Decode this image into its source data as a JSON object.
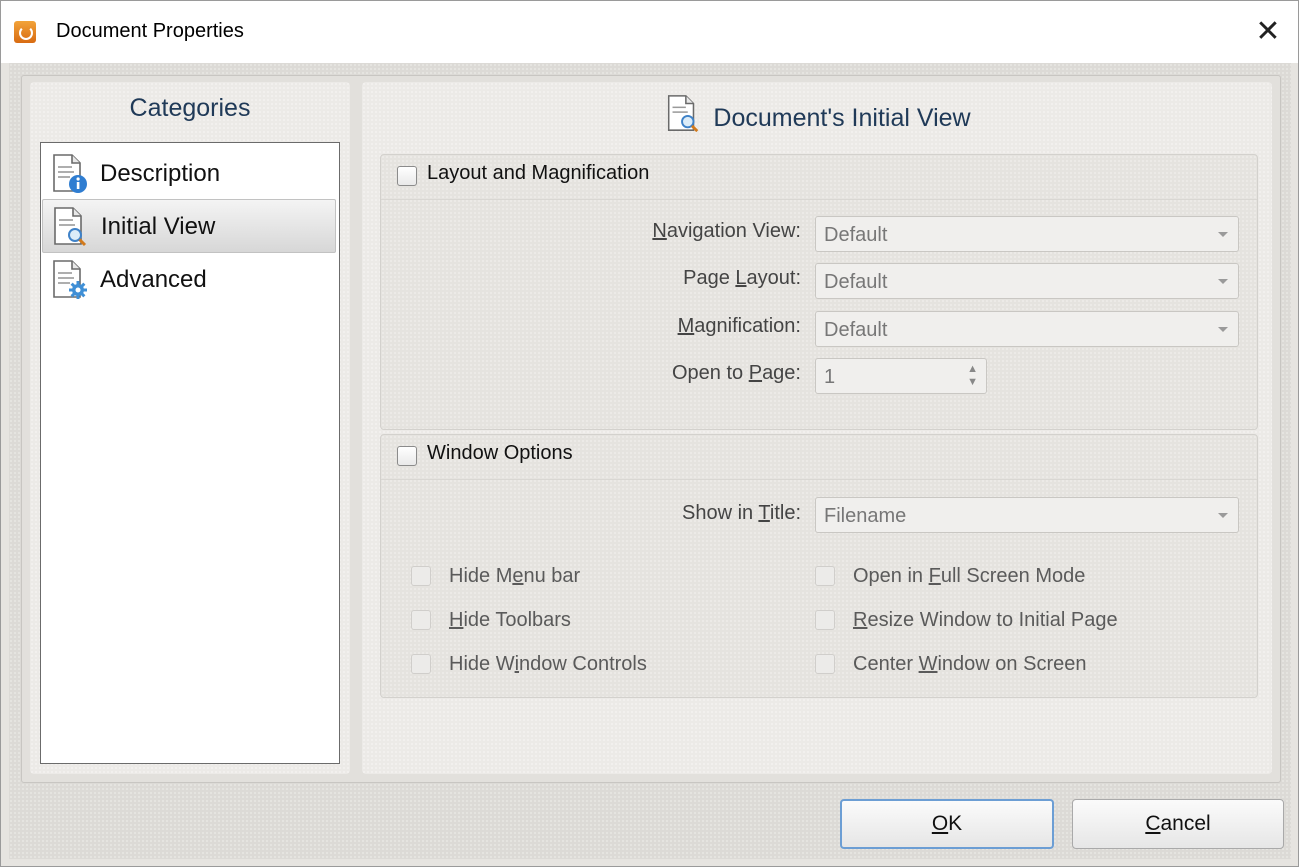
{
  "window": {
    "title": "Document Properties",
    "close_symbol": "✕"
  },
  "categories": {
    "heading": "Categories",
    "items": [
      {
        "label": "Description",
        "icon": "doc-info-icon",
        "selected": false
      },
      {
        "label": "Initial View",
        "icon": "doc-search-icon",
        "selected": true
      },
      {
        "label": "Advanced",
        "icon": "doc-gear-icon",
        "selected": false
      }
    ]
  },
  "main": {
    "heading": "Document's Initial View",
    "layout_group": {
      "title": "Layout and Magnification",
      "checked": false,
      "fields": {
        "navigation_view": {
          "label_pre": "",
          "label_key": "N",
          "label_post": "avigation View:",
          "value": "Default"
        },
        "page_layout": {
          "label_pre": "Page ",
          "label_key": "L",
          "label_post": "ayout:",
          "value": "Default"
        },
        "magnification": {
          "label_pre": "",
          "label_key": "M",
          "label_post": "agnification:",
          "value": "Default"
        },
        "open_to_page": {
          "label_pre": "Open to ",
          "label_key": "P",
          "label_post": "age:",
          "value": "1"
        }
      }
    },
    "window_group": {
      "title": "Window Options",
      "checked": false,
      "show_in_title": {
        "label_pre": "Show in ",
        "label_key": "T",
        "label_post": "itle:",
        "value": "Filename"
      },
      "options_left": [
        {
          "pre": "Hide M",
          "key": "e",
          "post": "nu bar"
        },
        {
          "pre": "",
          "key": "H",
          "post": "ide Toolbars"
        },
        {
          "pre": "Hide W",
          "key": "i",
          "post": "ndow Controls"
        }
      ],
      "options_right": [
        {
          "pre": "Open in ",
          "key": "F",
          "post": "ull Screen Mode"
        },
        {
          "pre": "",
          "key": "R",
          "post": "esize Window to Initial Page"
        },
        {
          "pre": "Center ",
          "key": "W",
          "post": "indow on Screen"
        }
      ]
    }
  },
  "buttons": {
    "ok": {
      "key": "O",
      "post": "K"
    },
    "cancel": {
      "key": "C",
      "post": "ancel"
    }
  }
}
